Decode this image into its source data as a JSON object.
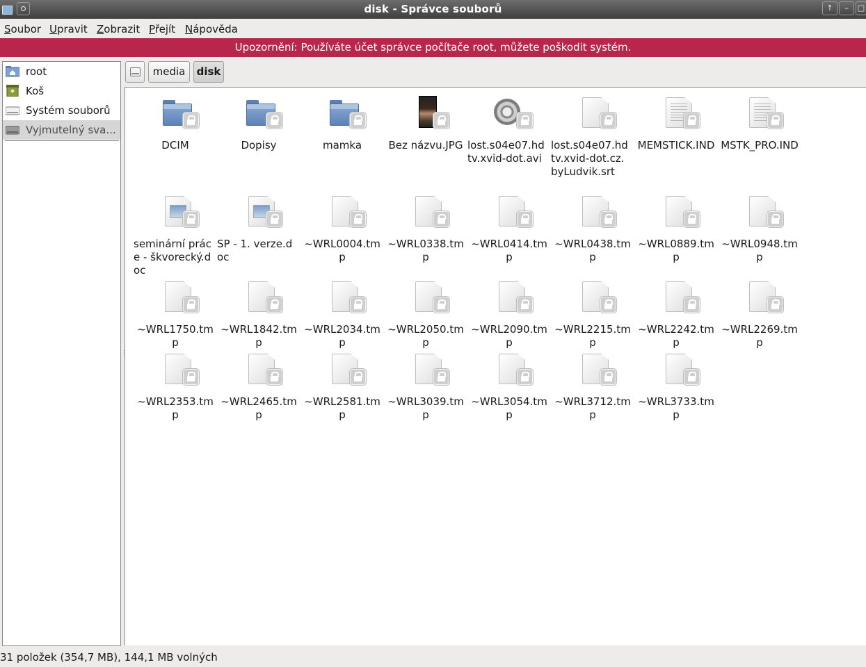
{
  "window": {
    "title": "disk - Správce souborů"
  },
  "menubar": {
    "items": [
      {
        "key": "S",
        "rest": "oubor"
      },
      {
        "key": "U",
        "rest": "pravit"
      },
      {
        "key": "Z",
        "rest": "obrazit"
      },
      {
        "key": "P",
        "rest": "řejít"
      },
      {
        "key": "N",
        "rest": "ápověda"
      }
    ]
  },
  "warning": "Upozornění: Používáte účet správce počítače root, můžete poškodit systém.",
  "sidebar": {
    "items": [
      {
        "label": "root",
        "icon": "home-folder-icon"
      },
      {
        "label": "Koš",
        "icon": "trash-icon"
      },
      {
        "label": "Systém souborů",
        "icon": "drive-icon"
      },
      {
        "label": "Vyjmutelný sva...",
        "icon": "removable-drive-icon"
      }
    ]
  },
  "pathbar": {
    "segments": [
      "media",
      "disk"
    ]
  },
  "files": [
    {
      "name": "DCIM",
      "type": "folder"
    },
    {
      "name": "Dopisy",
      "type": "folder"
    },
    {
      "name": "mamka",
      "type": "folder"
    },
    {
      "name": "Bez názvu.JPG",
      "type": "image"
    },
    {
      "name": "lost.s04e07.hdtv.xvid-dot.avi",
      "type": "video"
    },
    {
      "name": "lost.s04e07.hdtv.xvid-dot.cz.byLudvik.srt",
      "type": "blank"
    },
    {
      "name": "MEMSTICK.IND",
      "type": "text"
    },
    {
      "name": "MSTK_PRO.IND",
      "type": "text"
    },
    {
      "name": "seminární práce - škvorecký.doc",
      "type": "doc"
    },
    {
      "name": "SP - 1. verze.doc",
      "type": "doc"
    },
    {
      "name": "~WRL0004.tmp",
      "type": "blank"
    },
    {
      "name": "~WRL0338.tmp",
      "type": "blank"
    },
    {
      "name": "~WRL0414.tmp",
      "type": "blank"
    },
    {
      "name": "~WRL0438.tmp",
      "type": "blank"
    },
    {
      "name": "~WRL0889.tmp",
      "type": "blank"
    },
    {
      "name": "~WRL0948.tmp",
      "type": "blank"
    },
    {
      "name": "~WRL1750.tmp",
      "type": "blank"
    },
    {
      "name": "~WRL1842.tmp",
      "type": "blank"
    },
    {
      "name": "~WRL2034.tmp",
      "type": "blank"
    },
    {
      "name": "~WRL2050.tmp",
      "type": "blank"
    },
    {
      "name": "~WRL2090.tmp",
      "type": "blank"
    },
    {
      "name": "~WRL2215.tmp",
      "type": "blank"
    },
    {
      "name": "~WRL2242.tmp",
      "type": "blank"
    },
    {
      "name": "~WRL2269.tmp",
      "type": "blank"
    },
    {
      "name": "~WRL2353.tmp",
      "type": "blank"
    },
    {
      "name": "~WRL2465.tmp",
      "type": "blank"
    },
    {
      "name": "~WRL2581.tmp",
      "type": "blank"
    },
    {
      "name": "~WRL3039.tmp",
      "type": "blank"
    },
    {
      "name": "~WRL3054.tmp",
      "type": "blank"
    },
    {
      "name": "~WRL3712.tmp",
      "type": "blank"
    },
    {
      "name": "~WRL3733.tmp",
      "type": "blank"
    }
  ],
  "status": "31 položek (354,7 MB), 144,1 MB volných",
  "colors": {
    "warning_bg": "#b8264c",
    "titlebar": "#4a4a4a"
  }
}
